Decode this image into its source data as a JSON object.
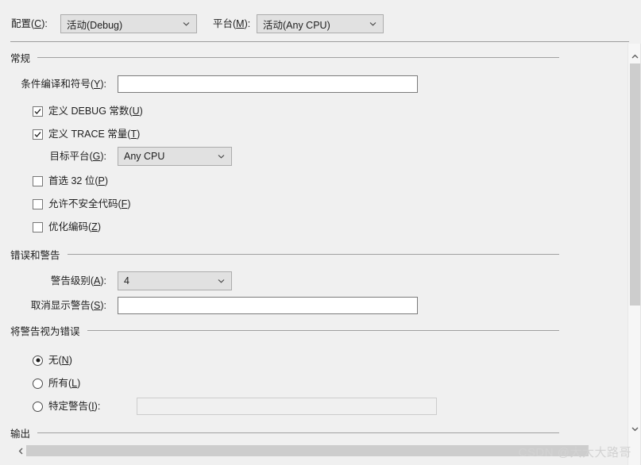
{
  "top_bar": {
    "configuration": {
      "label_prefix": "配置(",
      "label_accel": "C",
      "label_suffix": "):",
      "value": "活动(Debug)"
    },
    "platform": {
      "label_prefix": "平台(",
      "label_accel": "M",
      "label_suffix": "):",
      "value": "活动(Any CPU)"
    }
  },
  "groups": {
    "general": {
      "title": "常规",
      "conditional_symbols": {
        "label_prefix": "条件编译和符号(",
        "label_accel": "Y",
        "label_suffix": "):",
        "value": "",
        "placeholder": ""
      },
      "define_debug": {
        "label_prefix": "定义 DEBUG 常数(",
        "label_accel": "U",
        "label_suffix": ")",
        "checked": true
      },
      "define_trace": {
        "label_prefix": "定义 TRACE 常量(",
        "label_accel": "T",
        "label_suffix": ")",
        "checked": true
      },
      "target_platform": {
        "label_prefix": "目标平台(",
        "label_accel": "G",
        "label_suffix": "):",
        "value": "Any CPU"
      },
      "prefer_32bit": {
        "label_prefix": "首选 32 位(",
        "label_accel": "P",
        "label_suffix": ")",
        "checked": false
      },
      "allow_unsafe": {
        "label_prefix": "允许不安全代码(",
        "label_accel": "F",
        "label_suffix": ")",
        "checked": false
      },
      "optimize_code": {
        "label_prefix": "优化编码(",
        "label_accel": "Z",
        "label_suffix": ")",
        "checked": false
      }
    },
    "errors_warnings": {
      "title": "错误和警告",
      "warning_level": {
        "label_prefix": "警告级别(",
        "label_accel": "A",
        "label_suffix": "):",
        "value": "4"
      },
      "suppress_warnings": {
        "label_prefix": "取消显示警告(",
        "label_accel": "S",
        "label_suffix": "):",
        "value": "",
        "placeholder": ""
      }
    },
    "treat_warnings_as_errors": {
      "title": "将警告视为错误",
      "none": {
        "label_prefix": "无(",
        "label_accel": "N",
        "label_suffix": ")",
        "selected": true
      },
      "all": {
        "label_prefix": "所有(",
        "label_accel": "L",
        "label_suffix": ")",
        "selected": false
      },
      "specific": {
        "label_prefix": "特定警告(",
        "label_accel": "I",
        "label_suffix": "):",
        "selected": false,
        "value": "",
        "placeholder": ""
      }
    },
    "output": {
      "title": "输出"
    }
  },
  "watermark": {
    "text": "CSDN @大大大路哥"
  },
  "colors": {
    "background": "#f0f0f0",
    "combo_bg": "#e1e1e1",
    "combo_border": "#acacac",
    "textbox_bg": "#ffffff",
    "textbox_border": "#7a7a7a",
    "rule": "#a0a0a0",
    "scroll_thumb": "#cdcdcd",
    "watermark": "#d2d2d2"
  }
}
